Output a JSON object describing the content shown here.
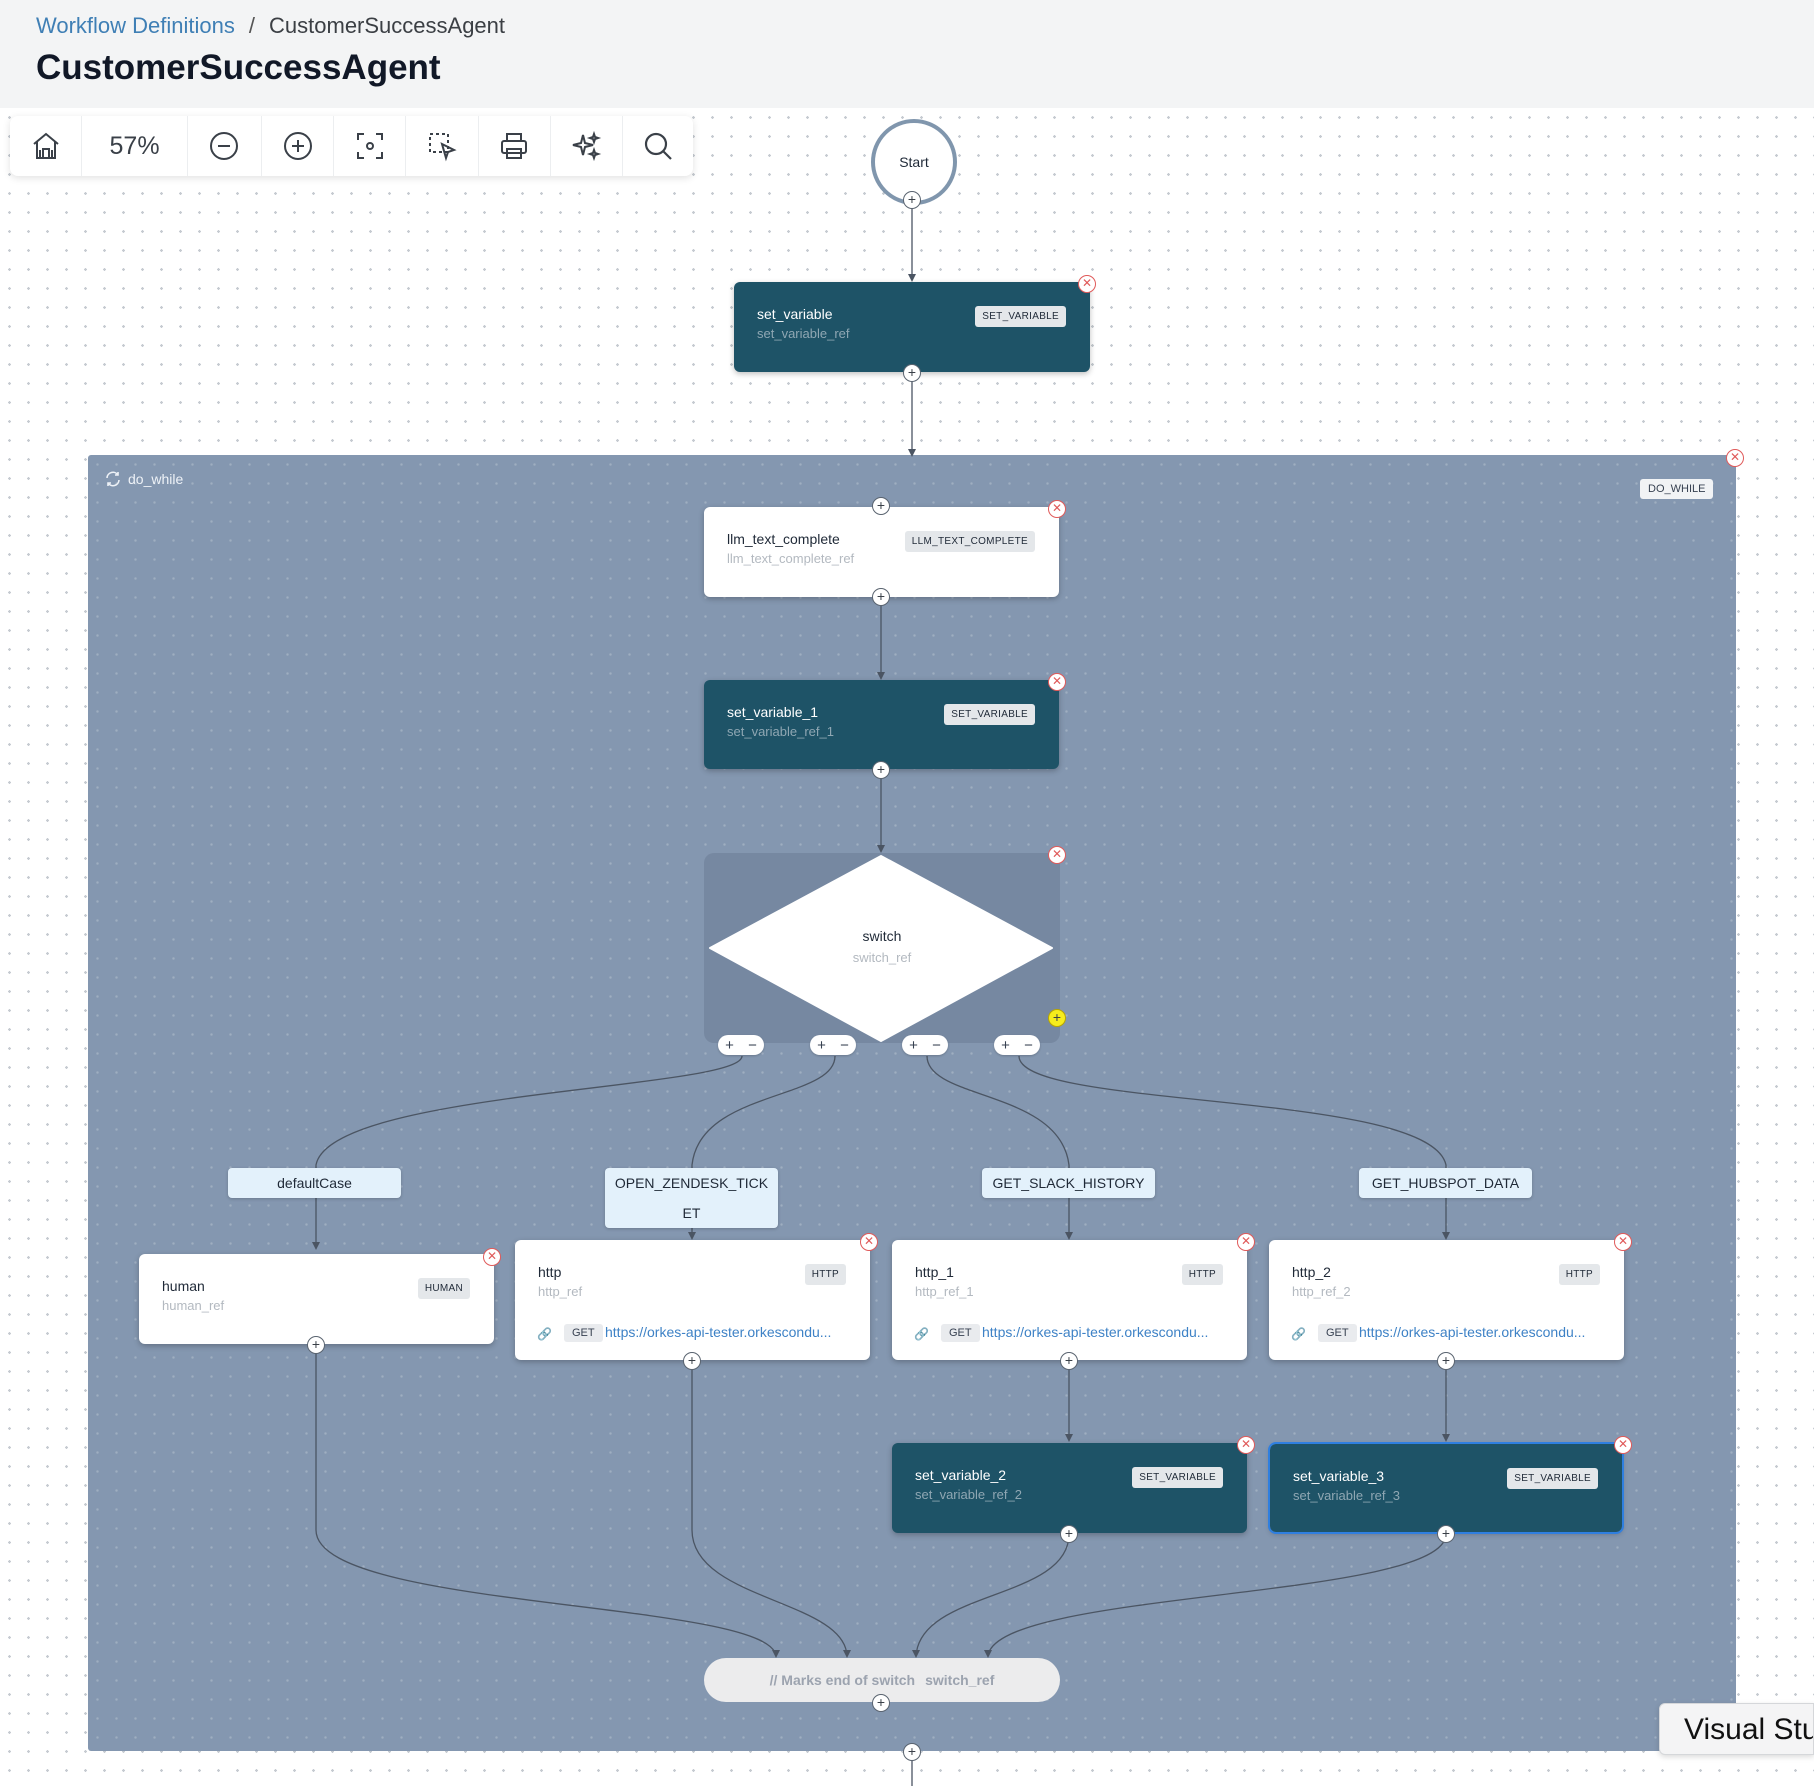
{
  "breadcrumb": {
    "link": "Workflow Definitions",
    "separator": "/",
    "current": "CustomerSuccessAgent"
  },
  "page_title": "CustomerSuccessAgent",
  "toolbar": {
    "zoom": "57%",
    "icons": [
      "home-icon",
      "zoom-out-icon",
      "zoom-in-icon",
      "fit-view-icon",
      "select-icon",
      "print-icon",
      "ai-sparkle-icon",
      "search-icon"
    ]
  },
  "start": {
    "label": "Start"
  },
  "set_variable": {
    "name": "set_variable",
    "ref": "set_variable_ref",
    "type": "SET_VARIABLE"
  },
  "loop": {
    "label": "do_while",
    "type": "DO_WHILE"
  },
  "llm": {
    "name": "llm_text_complete",
    "ref": "llm_text_complete_ref",
    "type": "LLM_TEXT_COMPLETE"
  },
  "set_variable_1": {
    "name": "set_variable_1",
    "ref": "set_variable_ref_1",
    "type": "SET_VARIABLE"
  },
  "switch": {
    "name": "switch",
    "ref": "switch_ref"
  },
  "cases": {
    "default": "defaultCase",
    "zendesk_line1": "OPEN_ZENDESK_TICK",
    "zendesk_line2": "ET",
    "slack": "GET_SLACK_HISTORY",
    "hubspot": "GET_HUBSPOT_DATA"
  },
  "human": {
    "name": "human",
    "ref": "human_ref",
    "type": "HUMAN"
  },
  "http": {
    "name": "http",
    "ref": "http_ref",
    "type": "HTTP",
    "method": "GET",
    "url": "https://orkes-api-tester.orkescondu..."
  },
  "http_1": {
    "name": "http_1",
    "ref": "http_ref_1",
    "type": "HTTP",
    "method": "GET",
    "url": "https://orkes-api-tester.orkescondu..."
  },
  "http_2": {
    "name": "http_2",
    "ref": "http_ref_2",
    "type": "HTTP",
    "method": "GET",
    "url": "https://orkes-api-tester.orkescondu..."
  },
  "set_variable_2": {
    "name": "set_variable_2",
    "ref": "set_variable_ref_2",
    "type": "SET_VARIABLE"
  },
  "set_variable_3": {
    "name": "set_variable_3",
    "ref": "set_variable_ref_3",
    "type": "SET_VARIABLE"
  },
  "join": {
    "comment": "// Marks end of switch",
    "ref": "switch_ref"
  },
  "side_tab": {
    "label": "Visual Stu"
  },
  "colors": {
    "dark_task": "#1e5367",
    "loop_bg": "#8497b0",
    "link": "#3f7fb5",
    "delete": "#e05a5a",
    "add_highlight": "#f6ec1c"
  }
}
